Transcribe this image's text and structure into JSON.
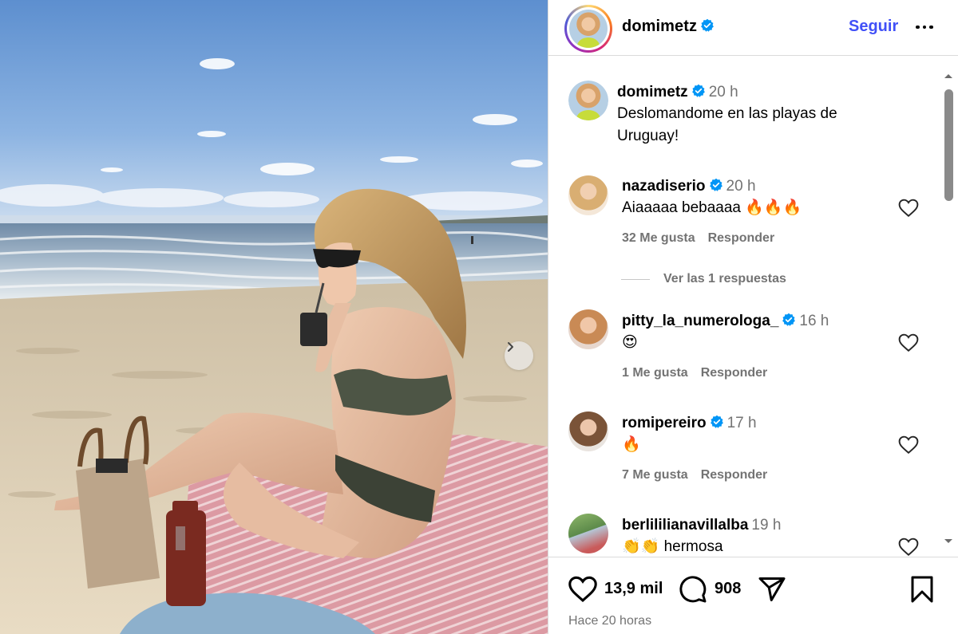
{
  "post": {
    "author": "domimetz",
    "follow_label": "Seguir",
    "caption": {
      "author": "domimetz",
      "time": "20 h",
      "line1": "Deslomandome en las playas de",
      "line2": "Uruguay!"
    },
    "comments": [
      {
        "user": "nazadiserio",
        "verified": true,
        "time": "20 h",
        "text": "Aiaaaaa bebaaaa 🔥🔥🔥",
        "likes": "32 Me gusta",
        "reply": "Responder",
        "avatar_color": "#e9c07c"
      },
      {
        "user": "pitty_la_numerologa_",
        "verified": true,
        "time": "16 h",
        "text": "😍",
        "likes": "1 Me gusta",
        "reply": "Responder",
        "avatar_color": "#d9a07f"
      },
      {
        "user": "romipereiro",
        "verified": true,
        "time": "17 h",
        "text": "🔥",
        "likes": "7 Me gusta",
        "reply": "Responder",
        "avatar_color": "#b38a6c"
      },
      {
        "user": "berlililianavillalba",
        "verified": false,
        "time": "19 h",
        "text": "👏👏 hermosa",
        "avatar_color": "#6e9c5a"
      }
    ],
    "view_replies": "Ver las 1 respuestas",
    "like_count": "13,9 mil",
    "comment_count": "908",
    "posted": "Hace 20 horas"
  },
  "colors": {
    "link_blue": "#4150f7",
    "verified_blue": "#0095f6",
    "muted": "#737373"
  },
  "icons": [
    "verified-badge-icon",
    "more-options-icon",
    "heart-icon",
    "comment-icon",
    "share-icon",
    "bookmark-icon",
    "chevron-right-icon"
  ]
}
